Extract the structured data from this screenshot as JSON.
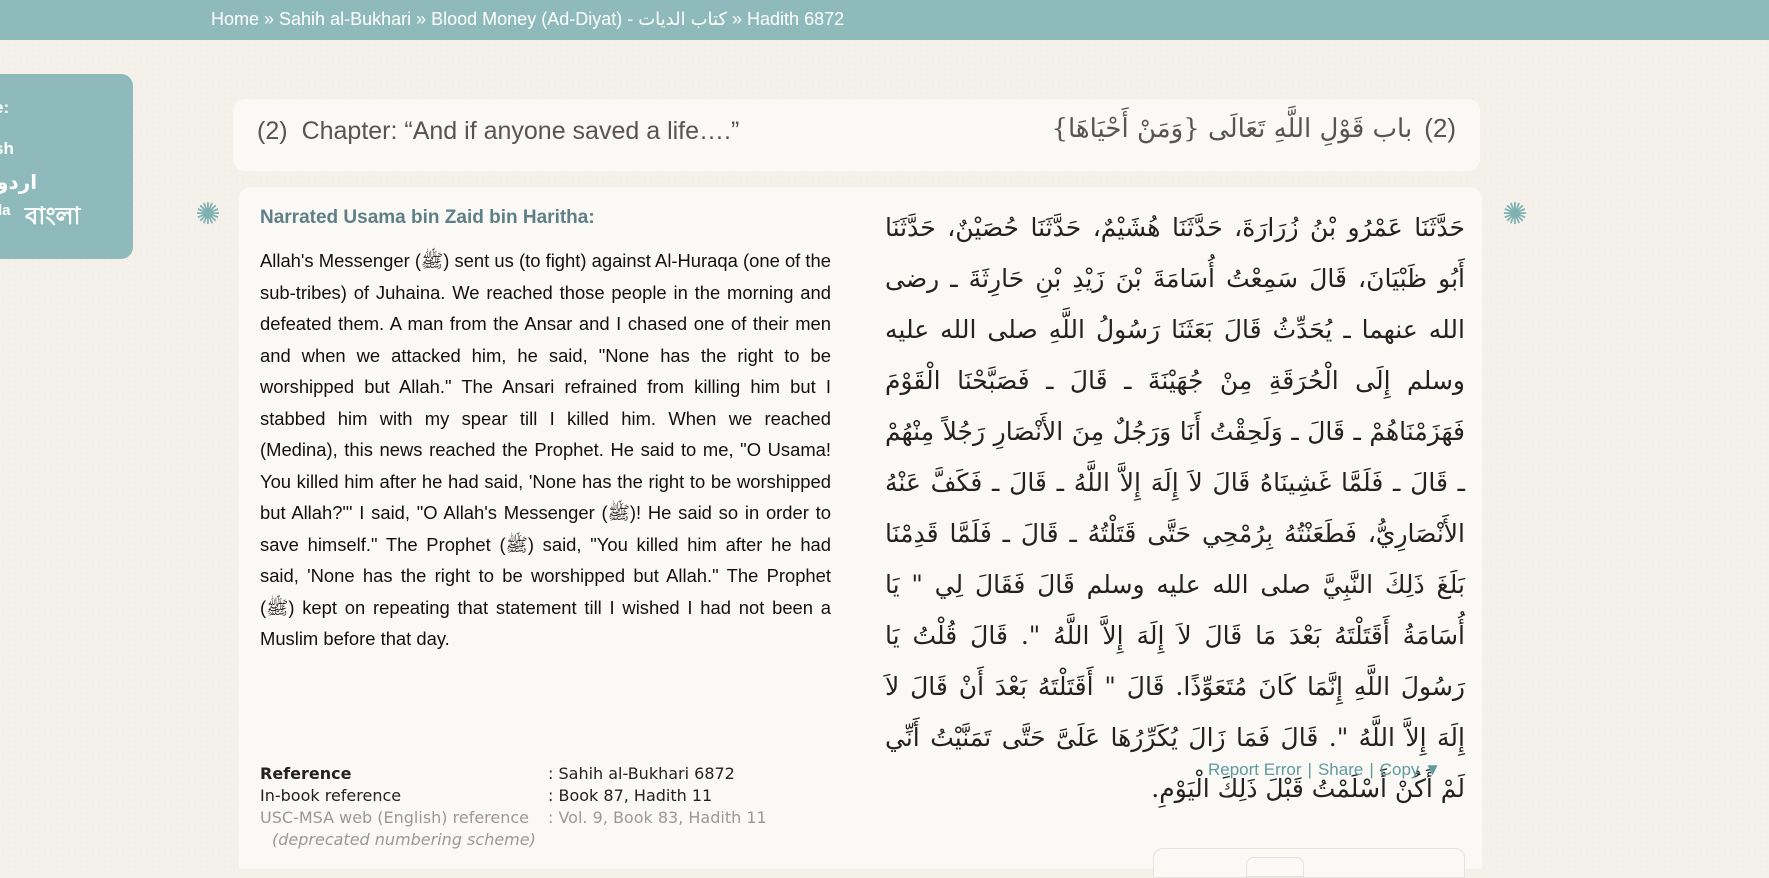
{
  "breadcrumb": {
    "home": "Home",
    "collection": "Sahih al-Bukhari",
    "book": "Blood Money (Ad-Diyat) - كتاب الديات",
    "hadith": "Hadith 6872",
    "separator": "»"
  },
  "language_panel": {
    "label": "e:",
    "items": [
      "sh",
      "اردو",
      "la",
      "বাংলা"
    ]
  },
  "chapter": {
    "number": "(2)",
    "title_en": "Chapter: “And if anyone saved a life….”",
    "title_ar": "باب قَوْلِ اللَّهِ تَعَالَى {وَمَنْ أَحْيَاهَا}"
  },
  "hadith": {
    "narrator": "Narrated Usama bin Zaid bin Haritha:",
    "text_en": "Allah's Messenger (ﷺ) sent us (to fight) against Al-Huraqa (one of the sub-tribes) of Juhaina. We reached those people in the morning and defeated them. A man from the Ansar and I chased one of their men and when we attacked him, he said, \"None has the right to be worshipped but Allah.\" The Ansari refrained from killing him but I stabbed him with my spear till I killed him. When we reached (Medina), this news reached the Prophet. He said to me, \"O Usama! You killed him after he had said, 'None has the right to be worshipped but Allah?\"' I said, \"O Allah's Messenger (ﷺ)! He said so in order to save himself.\" The Prophet (ﷺ) said, \"You killed him after he had said, 'None has the right to be worshipped but Allah.\" The Prophet (ﷺ) kept on repeating that statement till I wished I had not been a Muslim before that day.",
    "text_ar": "حَدَّثَنَا عَمْرُو بْنُ زُرَارَةَ، حَدَّثَنَا هُشَيْمٌ، حَدَّثَنَا حُصَيْنٌ، حَدَّثَنَا أَبُو ظَبْيَانَ، قَالَ سَمِعْتُ أُسَامَةَ بْنَ زَيْدِ بْنِ حَارِثَةَ ـ رضى الله عنهما ـ يُحَدِّثُ قَالَ بَعَثَنَا رَسُولُ اللَّهِ صلى الله عليه وسلم إِلَى الْحُرَقَةِ مِنْ جُهَيْنَةَ ـ قَالَ ـ فَصَبَّحْنَا الْقَوْمَ فَهَزَمْنَاهُمْ ـ قَالَ ـ وَلَحِقْتُ أَنَا وَرَجُلٌ مِنَ الأَنْصَارِ رَجُلاً مِنْهُمْ ـ قَالَ ـ فَلَمَّا غَشِينَاهُ قَالَ لاَ إِلَهَ إِلاَّ اللَّهُ ـ قَالَ ـ فَكَفَّ عَنْهُ الأَنْصَارِيُّ، فَطَعَنْتُهُ بِرُمْحِي حَتَّى قَتَلْتُهُ ـ قَالَ ـ فَلَمَّا قَدِمْنَا بَلَغَ ذَلِكَ النَّبِيَّ صلى الله عليه وسلم قَالَ فَقَالَ لِي \" يَا أُسَامَةُ أَقَتَلْتَهُ بَعْدَ مَا قَالَ لاَ إِلَهَ إِلاَّ اللَّهُ \". قَالَ قُلْتُ يَا رَسُولَ اللَّهِ إِنَّمَا كَانَ مُتَعَوِّذًا. قَالَ \" أَقَتَلْتَهُ بَعْدَ أَنْ قَالَ لاَ إِلَهَ إِلاَّ اللَّهُ \". قَالَ فَمَا زَالَ يُكَرِّرُهَا عَلَىَّ حَتَّى تَمَنَّيْتُ أَنِّي لَمْ أَكُنْ أَسْلَمْتُ قَبْلَ ذَلِكَ الْيَوْمِ."
  },
  "actions": {
    "report": "Report Error",
    "share": "Share",
    "copy": "Copy ▼",
    "separator": "|"
  },
  "references": [
    {
      "key": "Reference",
      "value": ": Sahih al-Bukhari 6872"
    },
    {
      "key": "In-book reference",
      "value": ": Book 87, Hadith 11"
    },
    {
      "key": "USC-MSA web (English) reference",
      "value": ": Vol. 9, Book 83, Hadith 11"
    }
  ],
  "deprecated_note": "(deprecated numbering scheme)",
  "colors": {
    "topbar": "#8fbabb",
    "accent": "#5f9a9f",
    "narrator": "#5f7f86"
  }
}
